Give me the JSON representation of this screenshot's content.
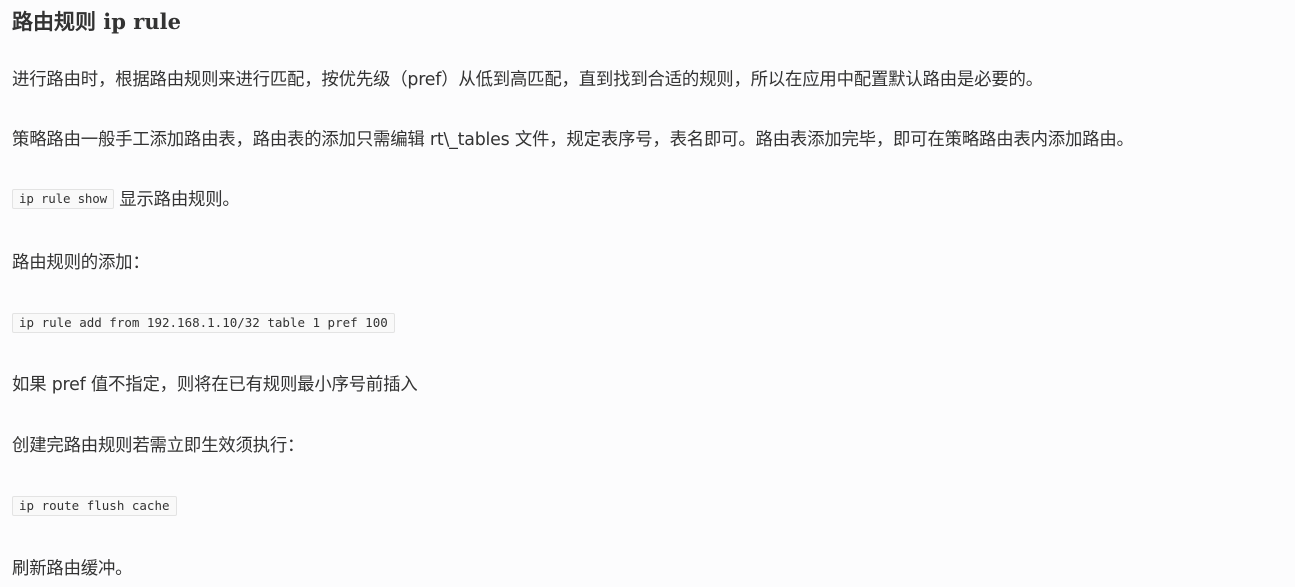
{
  "heading": "路由规则 ip rule",
  "para1": "进行路由时，根据路由规则来进行匹配，按优先级（pref）从低到高匹配，直到找到合适的规则，所以在应用中配置默认路由是必要的。",
  "para2": "策略路由一般手工添加路由表，路由表的添加只需编辑 rt\\_tables 文件，规定表序号，表名即可。路由表添加完毕，即可在策略路由表内添加路由。",
  "show_cmd": "ip rule show",
  "show_desc": "显示路由规则。",
  "add_heading": "路由规则的添加：",
  "add_cmd": "ip rule add from 192.168.1.10/32 table 1 pref 100",
  "pref_note": "如果 pref 值不指定，则将在已有规则最小序号前插入",
  "create_note": "创建完路由规则若需立即生效须执行：",
  "flush_cmd": "ip route flush cache",
  "flush_desc": "刷新路由缓冲。"
}
